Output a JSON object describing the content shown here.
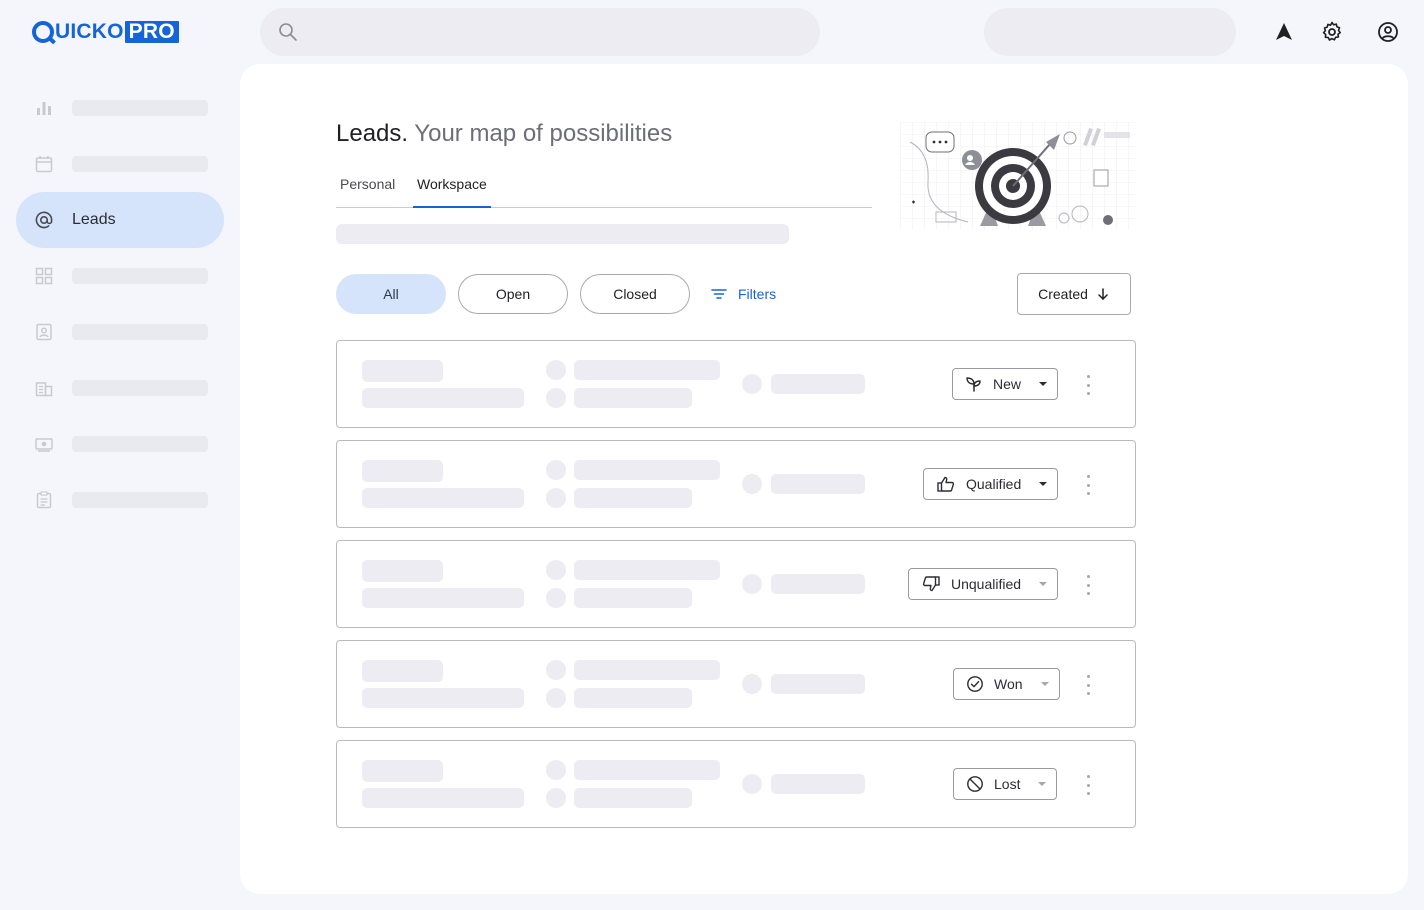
{
  "brand": {
    "word": "UICKO",
    "pro": "PRO",
    "accent": "#1565d8"
  },
  "header": {
    "search_icon": "search-icon",
    "icons": [
      "navigation-arrow-icon",
      "gear-icon",
      "account-circle-icon"
    ]
  },
  "sidebar": {
    "items": [
      {
        "icon": "bar-chart-icon",
        "label": ""
      },
      {
        "icon": "calendar-icon",
        "label": ""
      },
      {
        "icon": "at-sign-icon",
        "label": "Leads",
        "active": true
      },
      {
        "icon": "grid-icon",
        "label": ""
      },
      {
        "icon": "contact-card-icon",
        "label": ""
      },
      {
        "icon": "building-icon",
        "label": ""
      },
      {
        "icon": "cash-icon",
        "label": ""
      },
      {
        "icon": "clipboard-icon",
        "label": ""
      }
    ]
  },
  "main": {
    "title_strong": "Leads.",
    "title_soft": "Your map of possibilities",
    "tabs": [
      {
        "label": "Personal",
        "active": false
      },
      {
        "label": "Workspace",
        "active": true
      }
    ],
    "chips": [
      {
        "label": "All",
        "active": true
      },
      {
        "label": "Open",
        "active": false
      },
      {
        "label": "Closed",
        "active": false
      }
    ],
    "filters_label": "Filters",
    "sort_label": "Created",
    "rows": [
      {
        "status": "New",
        "icon": "sprout-icon"
      },
      {
        "status": "Qualified",
        "icon": "thumbs-up-icon"
      },
      {
        "status": "Unqualified",
        "icon": "thumbs-down-icon"
      },
      {
        "status": "Won",
        "icon": "check-circle-icon"
      },
      {
        "status": "Lost",
        "icon": "block-icon"
      }
    ]
  }
}
